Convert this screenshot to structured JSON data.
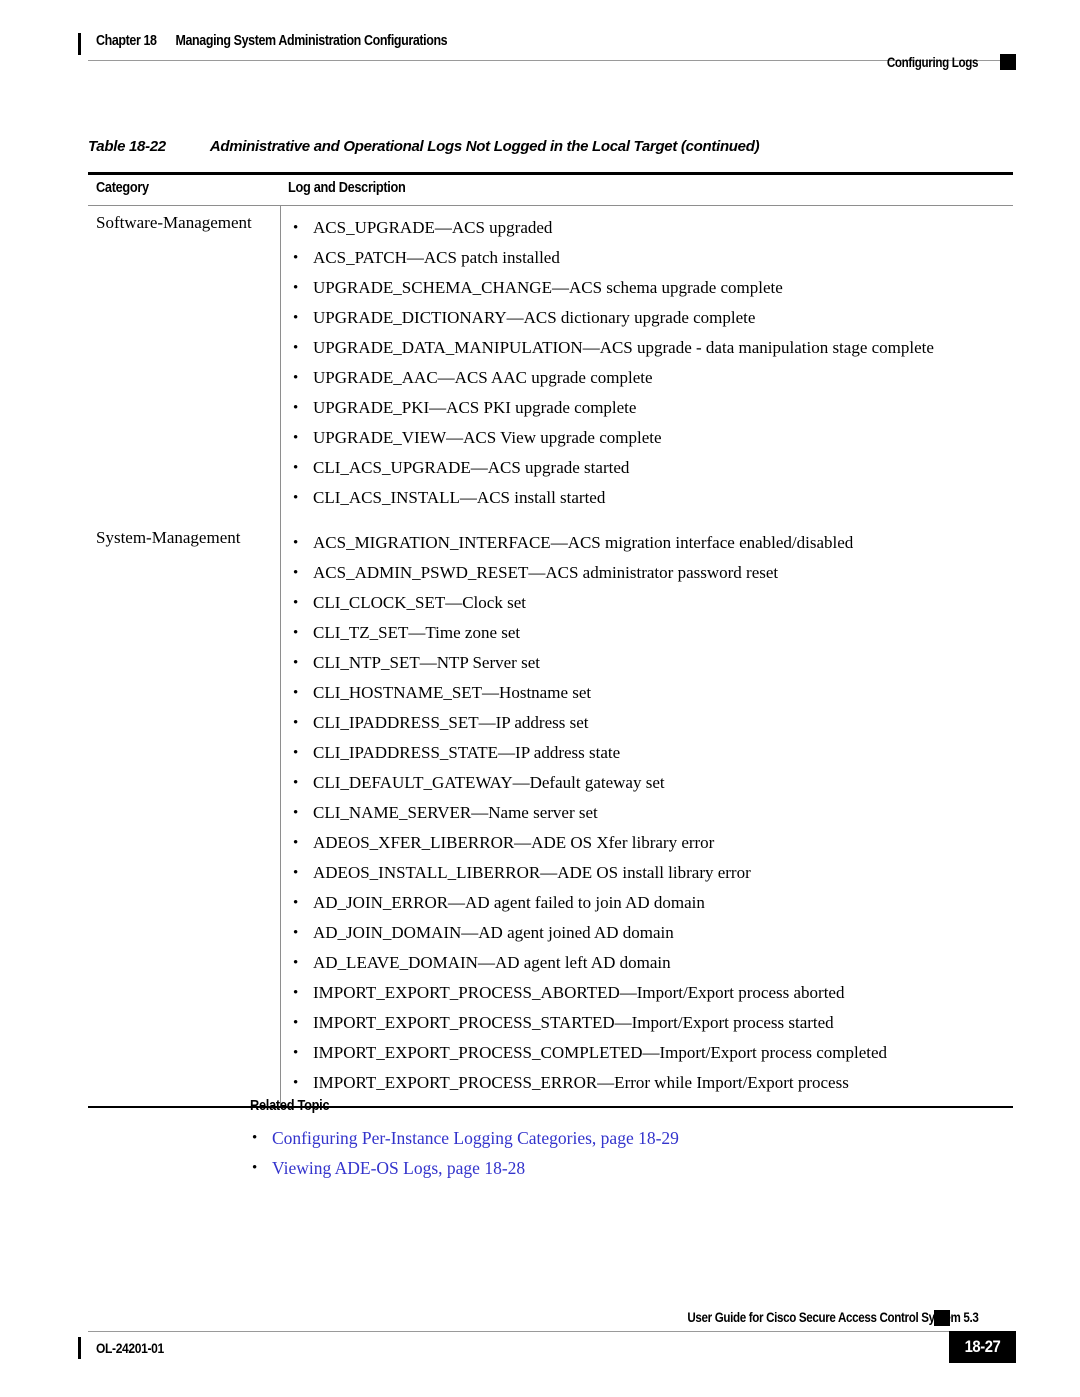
{
  "header": {
    "chapter_number": "Chapter 18",
    "chapter_title": "Managing System Administration Configurations",
    "section_title": "Configuring Logs"
  },
  "table": {
    "label": "Table 18-22",
    "caption": "Administrative and Operational Logs Not Logged in the Local Target (continued)",
    "columns": [
      "Category",
      "Log and Description"
    ],
    "groups": [
      {
        "category": "Software-Management",
        "entries": [
          "ACS_UPGRADE—ACS upgraded",
          "ACS_PATCH—ACS patch installed",
          "UPGRADE_SCHEMA_CHANGE—ACS schema upgrade complete",
          "UPGRADE_DICTIONARY—ACS dictionary upgrade complete",
          "UPGRADE_DATA_MANIPULATION—ACS upgrade - data manipulation stage complete",
          "UPGRADE_AAC—ACS AAC upgrade complete",
          "UPGRADE_PKI—ACS PKI upgrade complete",
          "UPGRADE_VIEW—ACS View upgrade complete",
          "CLI_ACS_UPGRADE—ACS upgrade started",
          "CLI_ACS_INSTALL—ACS install started"
        ]
      },
      {
        "category": "System-Management",
        "entries": [
          "ACS_MIGRATION_INTERFACE—ACS migration interface enabled/disabled",
          "ACS_ADMIN_PSWD_RESET—ACS administrator password reset",
          "CLI_CLOCK_SET—Clock set",
          "CLI_TZ_SET—Time zone set",
          "CLI_NTP_SET—NTP Server set",
          "CLI_HOSTNAME_SET—Hostname set",
          "CLI_IPADDRESS_SET—IP address set",
          "CLI_IPADDRESS_STATE—IP address state",
          "CLI_DEFAULT_GATEWAY—Default gateway set",
          "CLI_NAME_SERVER—Name server set",
          "ADEOS_XFER_LIBERROR—ADE OS Xfer library error",
          "ADEOS_INSTALL_LIBERROR—ADE OS install library error",
          "AD_JOIN_ERROR—AD agent failed to join AD domain",
          "AD_JOIN_DOMAIN—AD agent joined AD domain",
          "AD_LEAVE_DOMAIN—AD agent left AD domain",
          "IMPORT_EXPORT_PROCESS_ABORTED—Import/Export process aborted",
          "IMPORT_EXPORT_PROCESS_STARTED—Import/Export process started",
          "IMPORT_EXPORT_PROCESS_COMPLETED—Import/Export process completed",
          "IMPORT_EXPORT_PROCESS_ERROR—Error while Import/Export process"
        ]
      }
    ]
  },
  "related_topic": {
    "heading": "Related Topic",
    "links": [
      "Configuring Per-Instance Logging Categories, page 18-29",
      "Viewing ADE-OS Logs, page 18-28"
    ],
    "link_color": "#3333cc"
  },
  "footer": {
    "doc_id": "OL-24201-01",
    "guide_title": "User Guide for Cisco Secure Access Control System 5.3",
    "page_number": "18-27"
  },
  "bullet_glyph": "•"
}
